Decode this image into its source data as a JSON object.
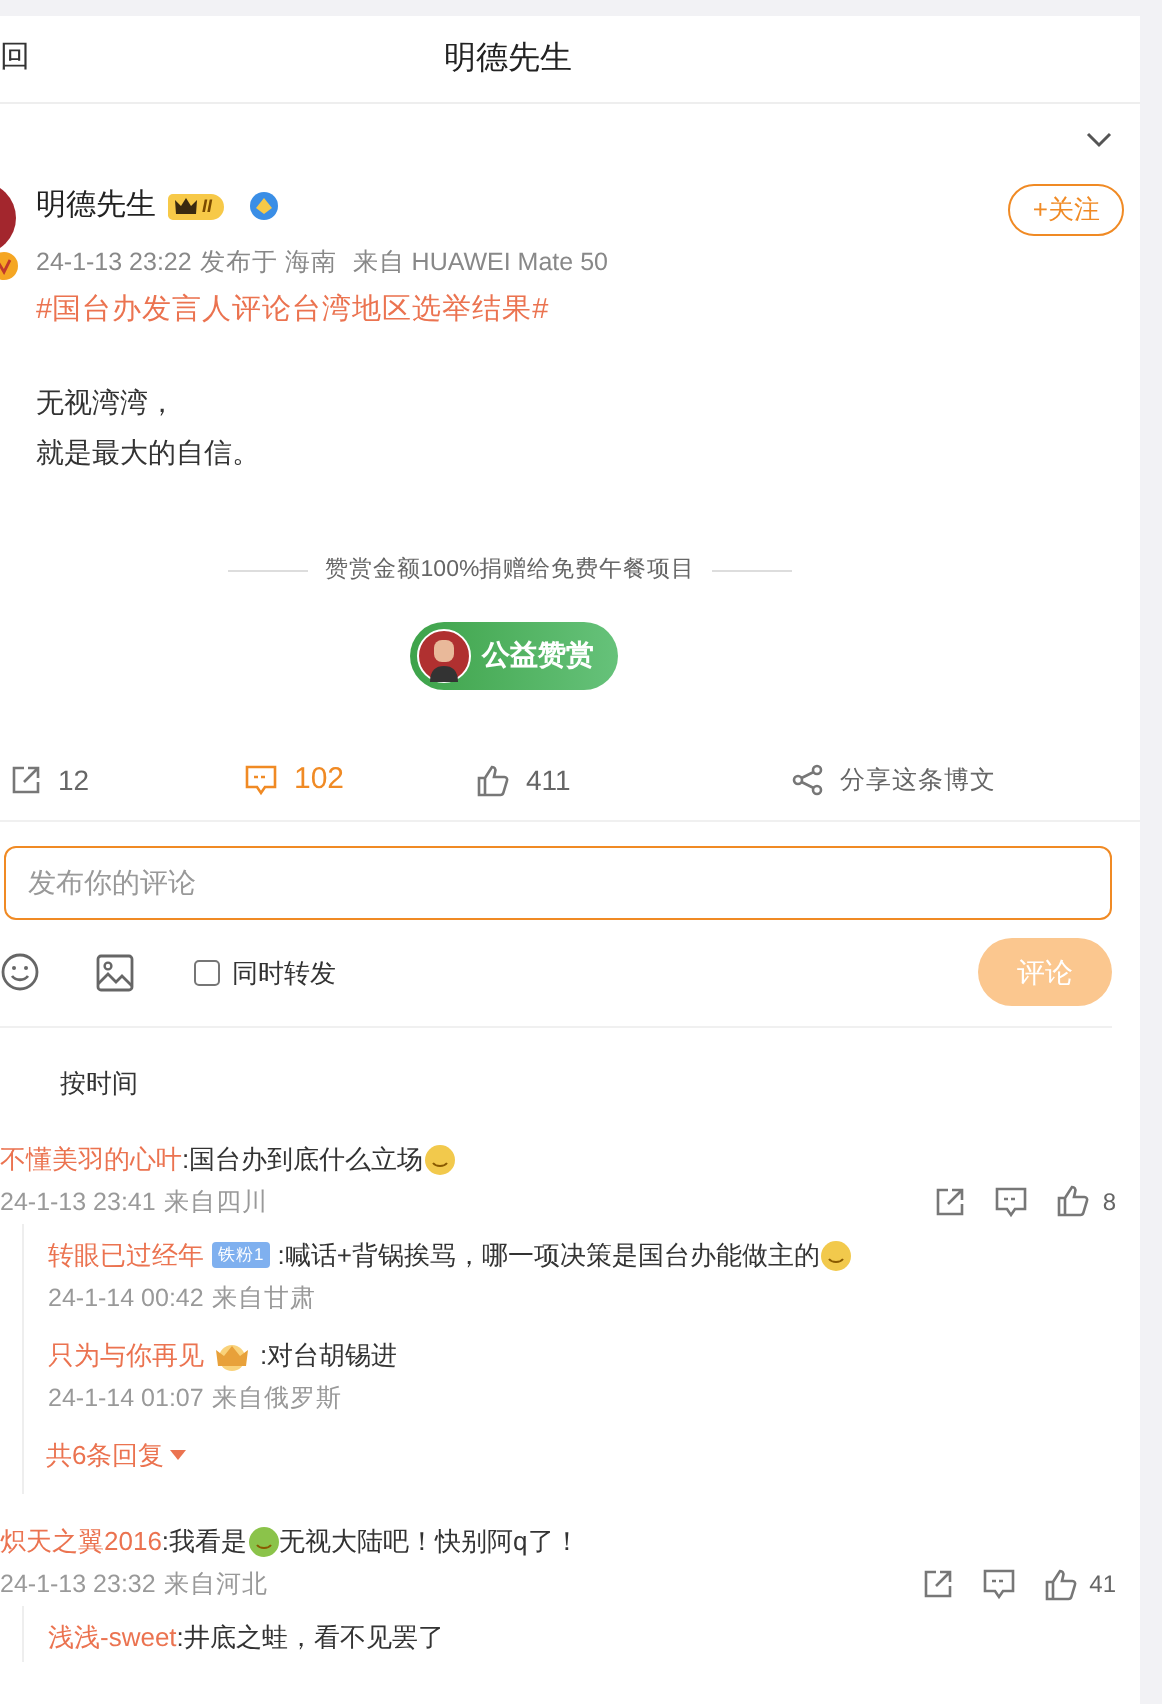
{
  "header": {
    "back_label": "回",
    "title": "明德先生"
  },
  "post": {
    "author": "明德先生",
    "vip_level": "II",
    "verified": true,
    "follow_label": "+关注",
    "time": "24-1-13 23:22",
    "location": "发布于 海南",
    "source": "来自 HUAWEI Mate 50",
    "hashtag": "#国台办发言人评论台湾地区选举结果#",
    "lines": [
      "无视湾湾，",
      "就是最大的自信。"
    ],
    "reward": {
      "note": "赞赏金额100%捐赠给免费午餐项目",
      "button": "公益赞赏"
    },
    "actions": [
      {
        "kind": "repost",
        "label": "12",
        "selected": false
      },
      {
        "kind": "comment",
        "label": "102",
        "selected": true
      },
      {
        "kind": "like",
        "label": "411",
        "selected": false
      },
      {
        "kind": "share",
        "label": "分享这条博文",
        "selected": false
      }
    ]
  },
  "composer": {
    "placeholder": "发布你的评论",
    "repost_label": "同时转发",
    "repost_checked": false,
    "submit_label": "评论",
    "submit_disabled": true
  },
  "sort_label": "按时间",
  "comments": [
    {
      "user": "不懂美羽的心叶",
      "parts": [
        {
          "kind": "text",
          "text": ":国台办到底什么立场"
        },
        {
          "kind": "emoji",
          "color": "#f2c94c"
        }
      ],
      "time": "24-1-13 23:41",
      "location": "来自四川",
      "likes": "8",
      "replies": [
        {
          "user": "转眼已过经年",
          "badge": {
            "kind": "fan",
            "text": "铁粉1"
          },
          "parts": [
            {
              "kind": "text",
              "text": ":喊话+背锅挨骂，哪一项决策是国台办能做主的"
            },
            {
              "kind": "emoji",
              "color": "#f2c94c"
            }
          ],
          "time": "24-1-14 00:42",
          "location": "来自甘肃"
        },
        {
          "user": "只为与你再见",
          "badge": {
            "kind": "crown"
          },
          "parts": [
            {
              "kind": "text",
              "text": ":对台胡锡进"
            }
          ],
          "time": "24-1-14 01:07",
          "location": "来自俄罗斯"
        }
      ],
      "more_replies": "共6条回复"
    },
    {
      "user": "炽天之翼2016",
      "parts": [
        {
          "kind": "text",
          "text": ":我看是"
        },
        {
          "kind": "emoji",
          "color": "#8bc34a"
        },
        {
          "kind": "text",
          "text": " 无视大陆吧！快别阿q了！"
        }
      ],
      "time": "24-1-13 23:32",
      "location": "来自河北",
      "likes": "41",
      "replies": [
        {
          "user": "浅浅-sweet",
          "parts": [
            {
              "kind": "text",
              "text": ":井底之蛙，看不见罢了"
            }
          ]
        }
      ]
    }
  ]
}
